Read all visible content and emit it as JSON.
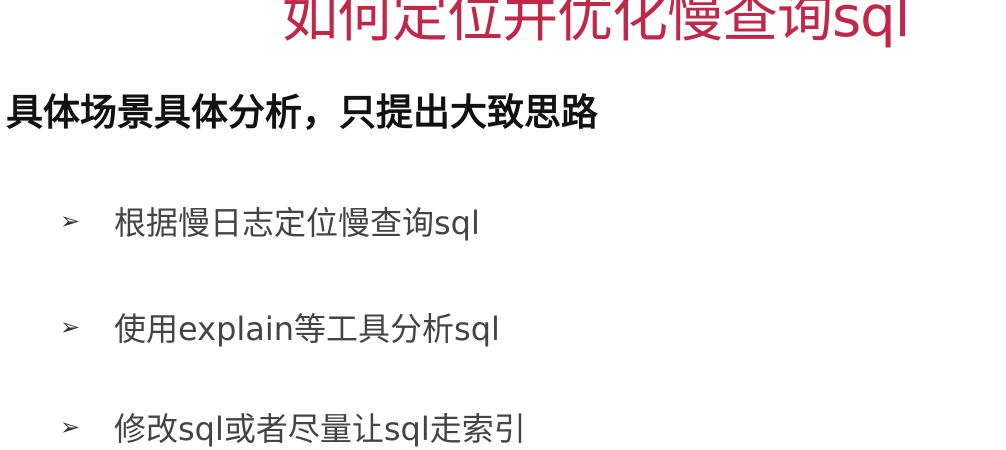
{
  "slide": {
    "title": "如何定位并优化慢查询sql",
    "subtitle": "具体场景具体分析，只提出大致思路",
    "bullets": [
      {
        "icon": "arrow-bullet-icon",
        "marker": "➢",
        "text": "根据慢日志定位慢查询sql"
      },
      {
        "icon": "arrow-bullet-icon",
        "marker": "➢",
        "text": "使用explain等工具分析sql"
      },
      {
        "icon": "arrow-bullet-icon",
        "marker": "➢",
        "text": "修改sql或者尽量让sql走索引"
      }
    ],
    "colors": {
      "title": "#c0284a",
      "text": "#444444"
    }
  }
}
